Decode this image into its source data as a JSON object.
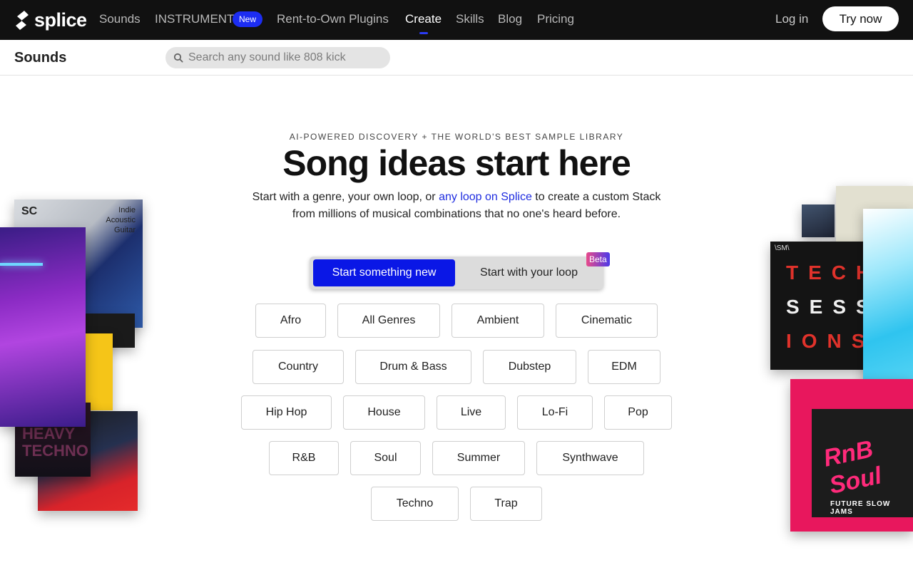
{
  "nav": {
    "logo_text": "splice",
    "links": [
      "Sounds",
      "INSTRUMENT",
      "Rent-to-Own Plugins",
      "Create",
      "Skills",
      "Blog",
      "Pricing"
    ],
    "new_badge": "New",
    "login": "Log in",
    "try_now": "Try now"
  },
  "subheader": {
    "title": "Sounds",
    "search_placeholder": "Search any sound like 808 kick"
  },
  "hero": {
    "eyebrow": "AI-POWERED DISCOVERY + THE WORLD'S BEST SAMPLE LIBRARY",
    "headline": "Song ideas start here",
    "desc_before": "Start with a genre, your own loop, or ",
    "desc_link": "any loop on Splice",
    "desc_after": " to create a custom Stack from millions of musical combinations that no one's heard before."
  },
  "toggle": {
    "active": "Start something new",
    "inactive": "Start with your loop",
    "beta": "Beta"
  },
  "genres": [
    [
      "Afro",
      "All Genres",
      "Ambient",
      "Cinematic"
    ],
    [
      "Country",
      "Drum & Bass",
      "Dubstep",
      "EDM"
    ],
    [
      "Hip Hop",
      "House",
      "Live",
      "Lo-Fi",
      "Pop"
    ],
    [
      "R&B",
      "Soul",
      "Summer",
      "Synthwave"
    ],
    [
      "Techno",
      "Trap"
    ]
  ],
  "artwork": {
    "left_1_brand": "SC",
    "left_1_title": "Indie Acoustic Guitar",
    "left_2_title": "HEAVY TECHNO",
    "right_1_title_lines": [
      "TECH",
      "SESS",
      "IONS"
    ],
    "right_1_brand": "\\SM\\",
    "right_2_title": "FUTURE SLOW JAMS",
    "right_2_script": "RnB Soul"
  }
}
